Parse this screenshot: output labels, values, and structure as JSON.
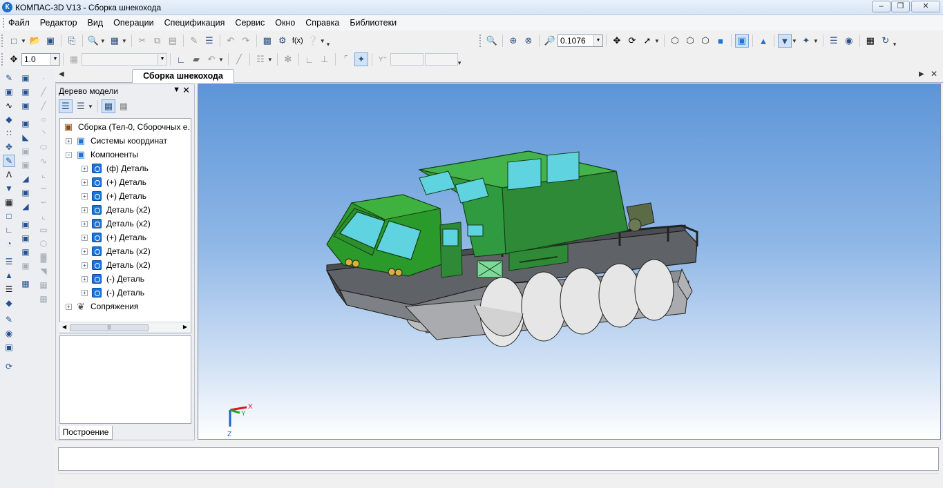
{
  "window": {
    "title": "КОМПАС-3D V13 - Сборка шнекохода",
    "app_icon_letter": "К",
    "controls": [
      "minimize",
      "maximize",
      "close"
    ]
  },
  "menu": {
    "items": [
      "Файл",
      "Редактор",
      "Вид",
      "Операции",
      "Спецификация",
      "Сервис",
      "Окно",
      "Справка",
      "Библиотеки"
    ]
  },
  "toolbar": {
    "zoom_value": "0.1076",
    "line_scale_value": "1.0",
    "layer_combo_value": ""
  },
  "document": {
    "tab_label": "Сборка шнекохода"
  },
  "tree": {
    "title": "Дерево модели",
    "root": "Сборка (Тел-0, Сборочных е...",
    "nodes": [
      {
        "label": "Системы координат",
        "level": 1,
        "icon": "coordinate-system-icon"
      },
      {
        "label": "Компоненты",
        "level": 1,
        "icon": "components-icon"
      },
      {
        "label": "(ф) Деталь",
        "level": 2,
        "icon": "part-icon"
      },
      {
        "label": "(+) Деталь",
        "level": 2,
        "icon": "part-icon"
      },
      {
        "label": "(+) Деталь",
        "level": 2,
        "icon": "part-icon"
      },
      {
        "label": "Деталь (x2)",
        "level": 2,
        "icon": "part-icon"
      },
      {
        "label": "Деталь (x2)",
        "level": 2,
        "icon": "part-icon"
      },
      {
        "label": "(+) Деталь",
        "level": 2,
        "icon": "part-icon"
      },
      {
        "label": "Деталь (x2)",
        "level": 2,
        "icon": "part-icon"
      },
      {
        "label": "Деталь (x2)",
        "level": 2,
        "icon": "part-icon"
      },
      {
        "label": "(-) Деталь",
        "level": 2,
        "icon": "part-icon"
      },
      {
        "label": "(-) Деталь",
        "level": 2,
        "icon": "part-icon"
      },
      {
        "label": "Сопряжения",
        "level": 1,
        "icon": "mates-icon"
      }
    ],
    "bottom_tab": "Построение"
  },
  "viewport": {
    "axis_labels": {
      "x": "X",
      "y": "Y",
      "z": "Z"
    },
    "colors": {
      "body": "#2f9a2f",
      "cabin": "#3aa83a",
      "glass": "#5fd4e0",
      "chassis": "#6e7175",
      "auger": "#dcdcdc"
    }
  }
}
